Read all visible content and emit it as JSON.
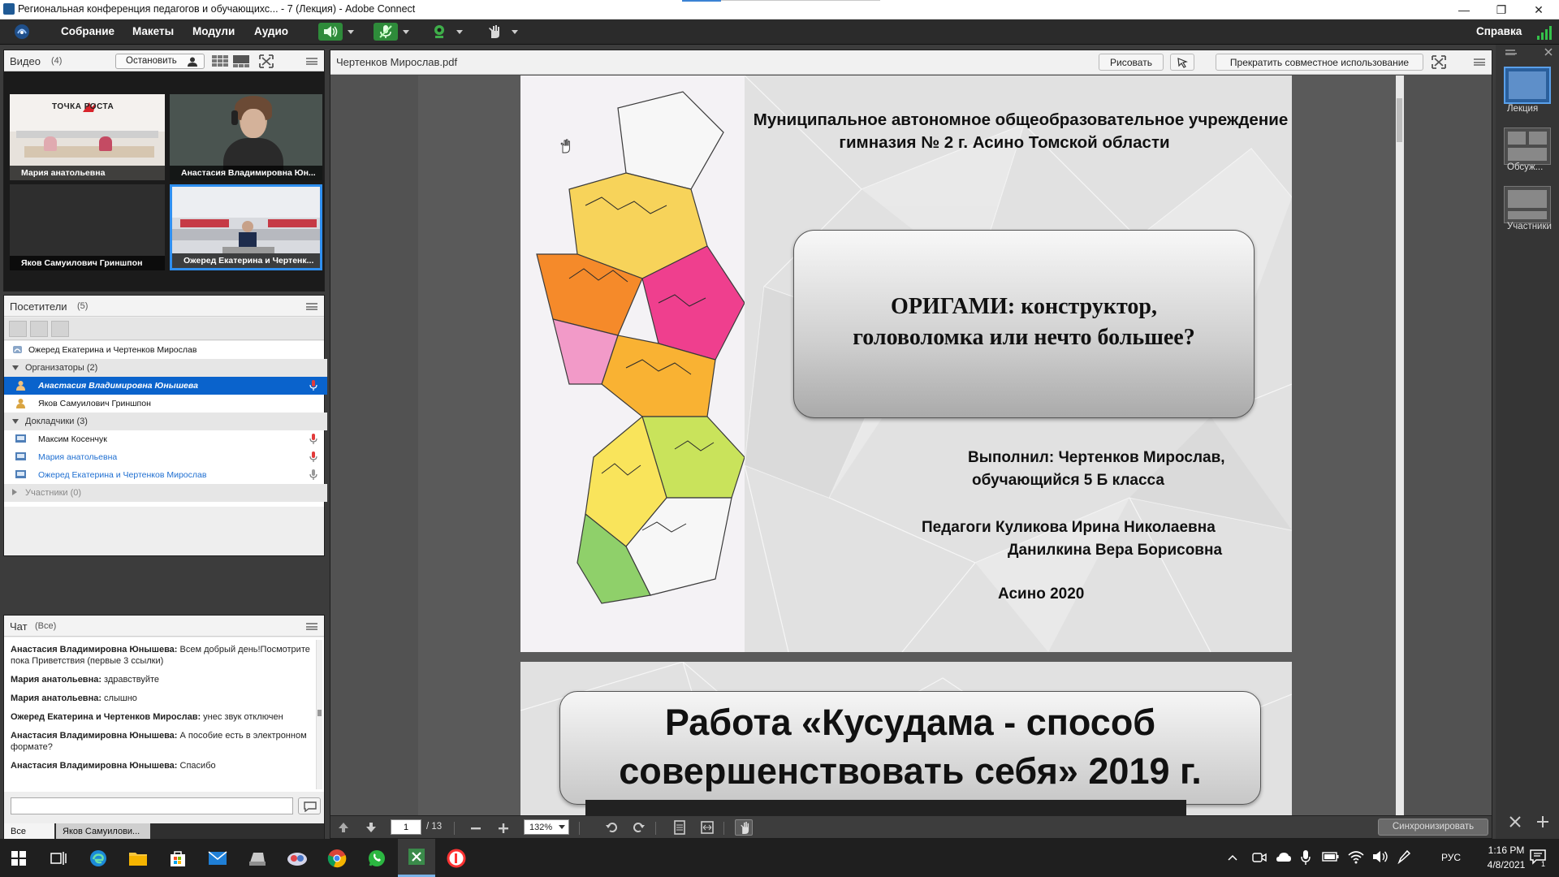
{
  "window": {
    "title": "Региональная конференция педагогов и обучающихс... - 7 (Лекция) - Adobe Connect",
    "minimize": "—",
    "restore": "❐",
    "close": "✕"
  },
  "menubar": {
    "items": [
      "Собрание",
      "Макеты",
      "Модули",
      "Аудио"
    ],
    "help": "Справка"
  },
  "video_pod": {
    "title": "Видео",
    "count": "(4)",
    "stop_button": "Остановить",
    "tiles": [
      {
        "name": "Мария анатольевна",
        "banner": "ТОЧКА РОСТА"
      },
      {
        "name": "Анастасия Владимировна Юн..."
      },
      {
        "name": "Яков Самуилович Гриншпон"
      },
      {
        "name": "Ожеред  Екатерина и Чертенк..."
      }
    ]
  },
  "attendees_pod": {
    "title": "Посетители",
    "count": "(5)",
    "top_user": "Ожеред  Екатерина и Чертенков Мирослав",
    "groups": [
      {
        "label": "Организаторы (2)",
        "members": [
          "Анастасия Владимировна Юнышева",
          "Яков Самуилович Гриншпон"
        ]
      },
      {
        "label": "Докладчики (3)",
        "members": [
          "Максим Косенчук",
          "Мария анатольевна",
          "Ожеред  Екатерина и Чертенков Мирослав"
        ]
      },
      {
        "label": "Участники (0)",
        "members": []
      }
    ]
  },
  "chat_pod": {
    "title": "Чат",
    "scope": "(Все)",
    "messages": [
      {
        "author": "Анастасия Владимировна Юнышева:",
        "text": " Всем добрый день!Посмотрите пока Приветствия (первые 3 ссылки)"
      },
      {
        "author": "Мария анатольевна:",
        "text": " здравствуйте"
      },
      {
        "author": "Мария анатольевна:",
        "text": " слышно"
      },
      {
        "author": "Ожеред  Екатерина и Чертенков Мирослав:",
        "text": " унес звук отключен"
      },
      {
        "author": "Анастасия Владимировна Юнышева:",
        "text": " А пособие есть в электронном формате?"
      },
      {
        "author": "Анастасия Владимировна Юнышева:",
        "text": " Спасибо"
      }
    ],
    "input_value": "",
    "tabs": [
      "Все",
      "Яков Самуилови..."
    ]
  },
  "share_pod": {
    "file_name": "Чертенков Мирослав.pdf",
    "draw_button": "Рисовать",
    "stop_share_button": "Прекратить совместное использование",
    "page_current": "1",
    "page_total": "/ 13",
    "zoom": "132%",
    "sync_button": "Синхронизировать"
  },
  "slide1": {
    "org_line1": "Муниципальное автономное общеобразовательное учреждение",
    "org_line2": "гимназия № 2 г. Асино Томской области",
    "title_line1": "ОРИГАМИ: конструктор,",
    "title_line2": "головоломка или нечто большее?",
    "author_line1": "Выполнил: Чертенков Мирослав,",
    "author_line2": "обучающийся 5 Б класса",
    "teacher_line1": "Педагоги Куликова Ирина Николаевна",
    "teacher_line2": "Данилкина Вера Борисовна",
    "city_year": "Асино 2020"
  },
  "slide2": {
    "title_line1": "Работа «Кусудама - способ",
    "title_line2": "совершенствовать себя» 2019 г."
  },
  "layouts": [
    {
      "label": "Лекция"
    },
    {
      "label": "Обсуж..."
    },
    {
      "label": "Участники"
    }
  ],
  "taskbar": {
    "language": "РУС",
    "time": "1:16 PM",
    "date": "4/8/2021",
    "notifications": "1"
  },
  "colors": {
    "selection": "#0a63cc",
    "accent_green": "#2e9e3e",
    "presenter_blue": "#1f6fd1"
  }
}
